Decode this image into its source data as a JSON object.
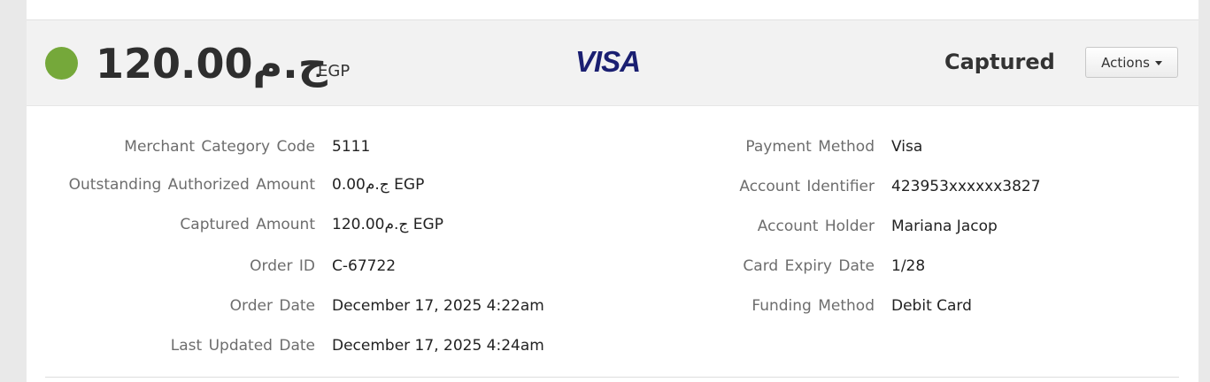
{
  "header": {
    "status_color": "#75a83a",
    "amount": "120.00ج.م",
    "currency_code": "EGP",
    "card_brand": "VISA",
    "status": "Captured",
    "actions_label": "Actions"
  },
  "details_left": [
    {
      "label": "Merchant Category Code",
      "value": "5111"
    },
    {
      "label": "Outstanding Authorized Amount",
      "value": "0.00ج.م EGP"
    },
    {
      "label": "Captured Amount",
      "value": "120.00ج.م EGP"
    },
    {
      "label": "Order ID",
      "value": "C-67722"
    },
    {
      "label": "Order Date",
      "value": "December 17, 2025 4:22am"
    },
    {
      "label": "Last Updated Date",
      "value": "December 17, 2025 4:24am"
    }
  ],
  "details_right": [
    {
      "label": "Payment Method",
      "value": "Visa"
    },
    {
      "label": "Account Identifier",
      "value": "423953xxxxxx3827"
    },
    {
      "label": "Account Holder",
      "value": "Mariana Jacop"
    },
    {
      "label": "Card Expiry Date",
      "value": "1/28"
    },
    {
      "label": "Funding Method",
      "value": "Debit Card"
    }
  ]
}
